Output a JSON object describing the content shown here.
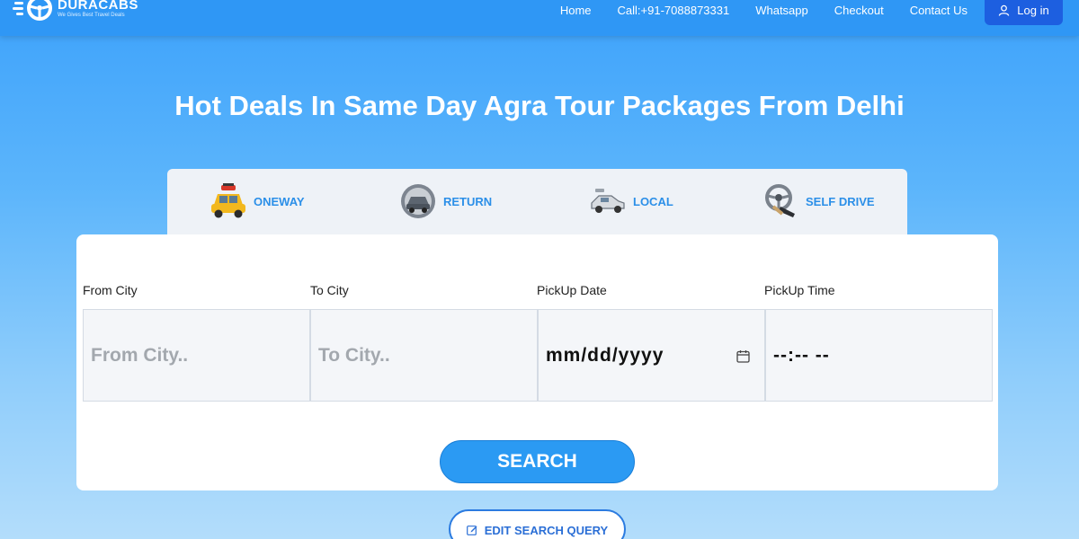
{
  "brand": {
    "name": "DURACABS",
    "tagline": "We Gives Best Travel Deals",
    "logo_icon": "steering-wheel-icon"
  },
  "nav": {
    "items": [
      "Home",
      "Call:+91-7088873331",
      "Whatsapp",
      "Checkout",
      "Contact Us"
    ],
    "login_label": "Log in"
  },
  "hero": {
    "title": "Hot Deals In Same Day Agra Tour Packages From Delhi"
  },
  "tabs": [
    {
      "label": "ONEWAY",
      "icon": "taxi-icon"
    },
    {
      "label": "RETURN",
      "icon": "return-car-icon"
    },
    {
      "label": "LOCAL",
      "icon": "local-car-icon"
    },
    {
      "label": "SELF DRIVE",
      "icon": "steering-wheel-icon"
    }
  ],
  "form": {
    "from_label": "From City",
    "from_placeholder": "From City..",
    "to_label": "To City",
    "to_placeholder": "To City..",
    "date_label": "PickUp Date",
    "date_value": "mm/dd/yyyy",
    "time_label": "PickUp Time",
    "time_value": "--:-- --",
    "search_label": "SEARCH"
  },
  "edit_label": "EDIT SEARCH QUERY",
  "colors": {
    "header": "#2f97f5",
    "accent": "#2b9af3",
    "login": "#1d5fe0",
    "tab_text": "#2b8fe8"
  }
}
